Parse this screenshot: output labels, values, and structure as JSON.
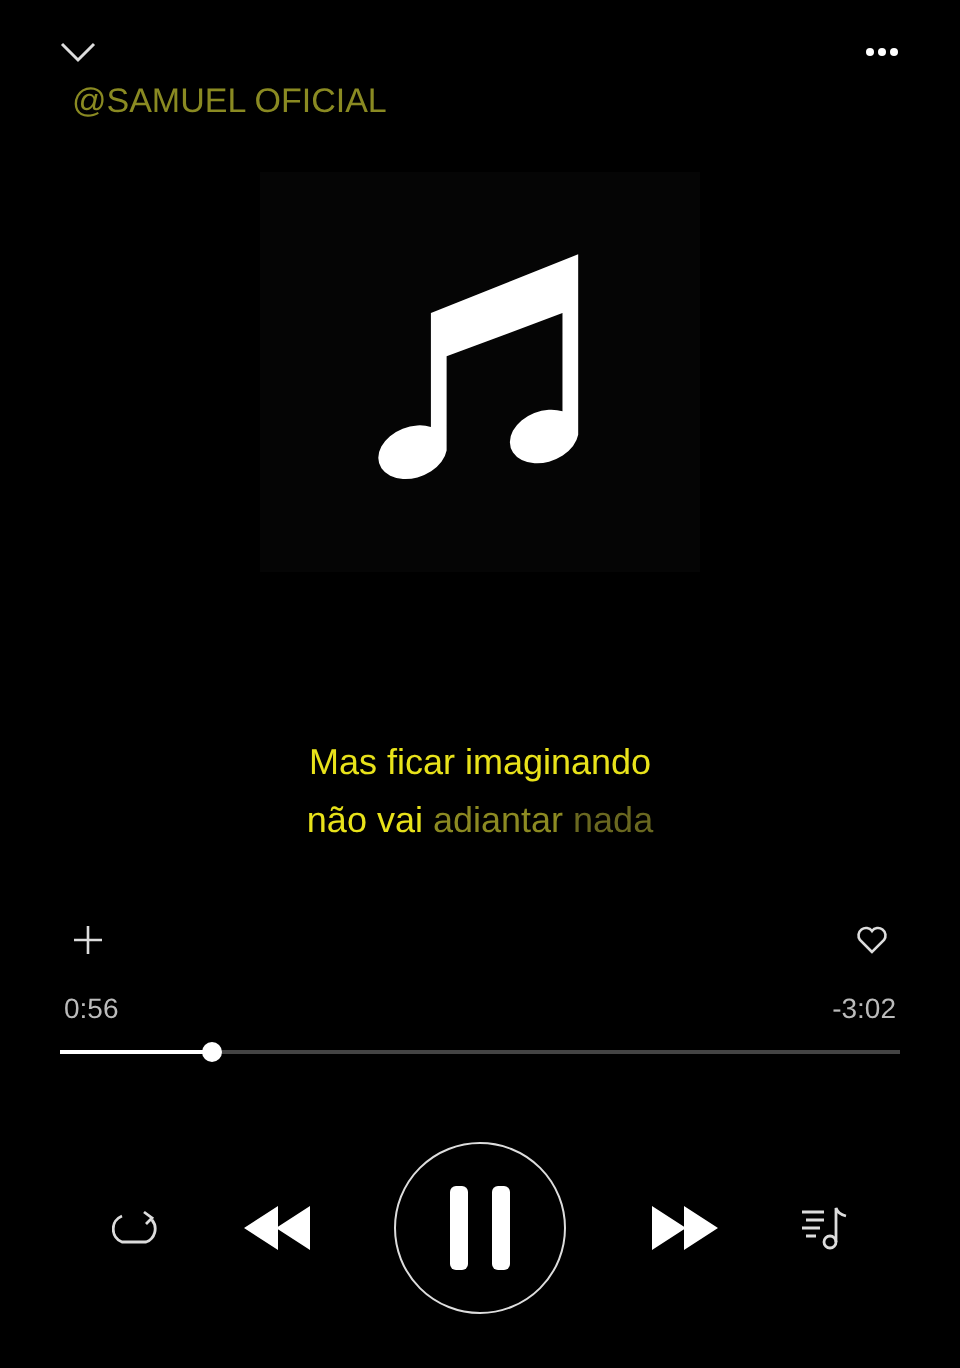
{
  "header": {
    "title": "@SAMUEL OFICIAL"
  },
  "lyrics": [
    {
      "segments": [
        {
          "text": "Mas ficar imaginando",
          "kind": "sung"
        }
      ]
    },
    {
      "segments": [
        {
          "text": "não vai",
          "kind": "sung"
        },
        {
          "text": "adiantar",
          "kind": "upcoming"
        },
        {
          "text": "nada",
          "kind": "faint"
        }
      ]
    }
  ],
  "progress": {
    "elapsed": "0:56",
    "remaining": "-3:02",
    "level": 0.18
  },
  "playback": {
    "playing": true
  }
}
